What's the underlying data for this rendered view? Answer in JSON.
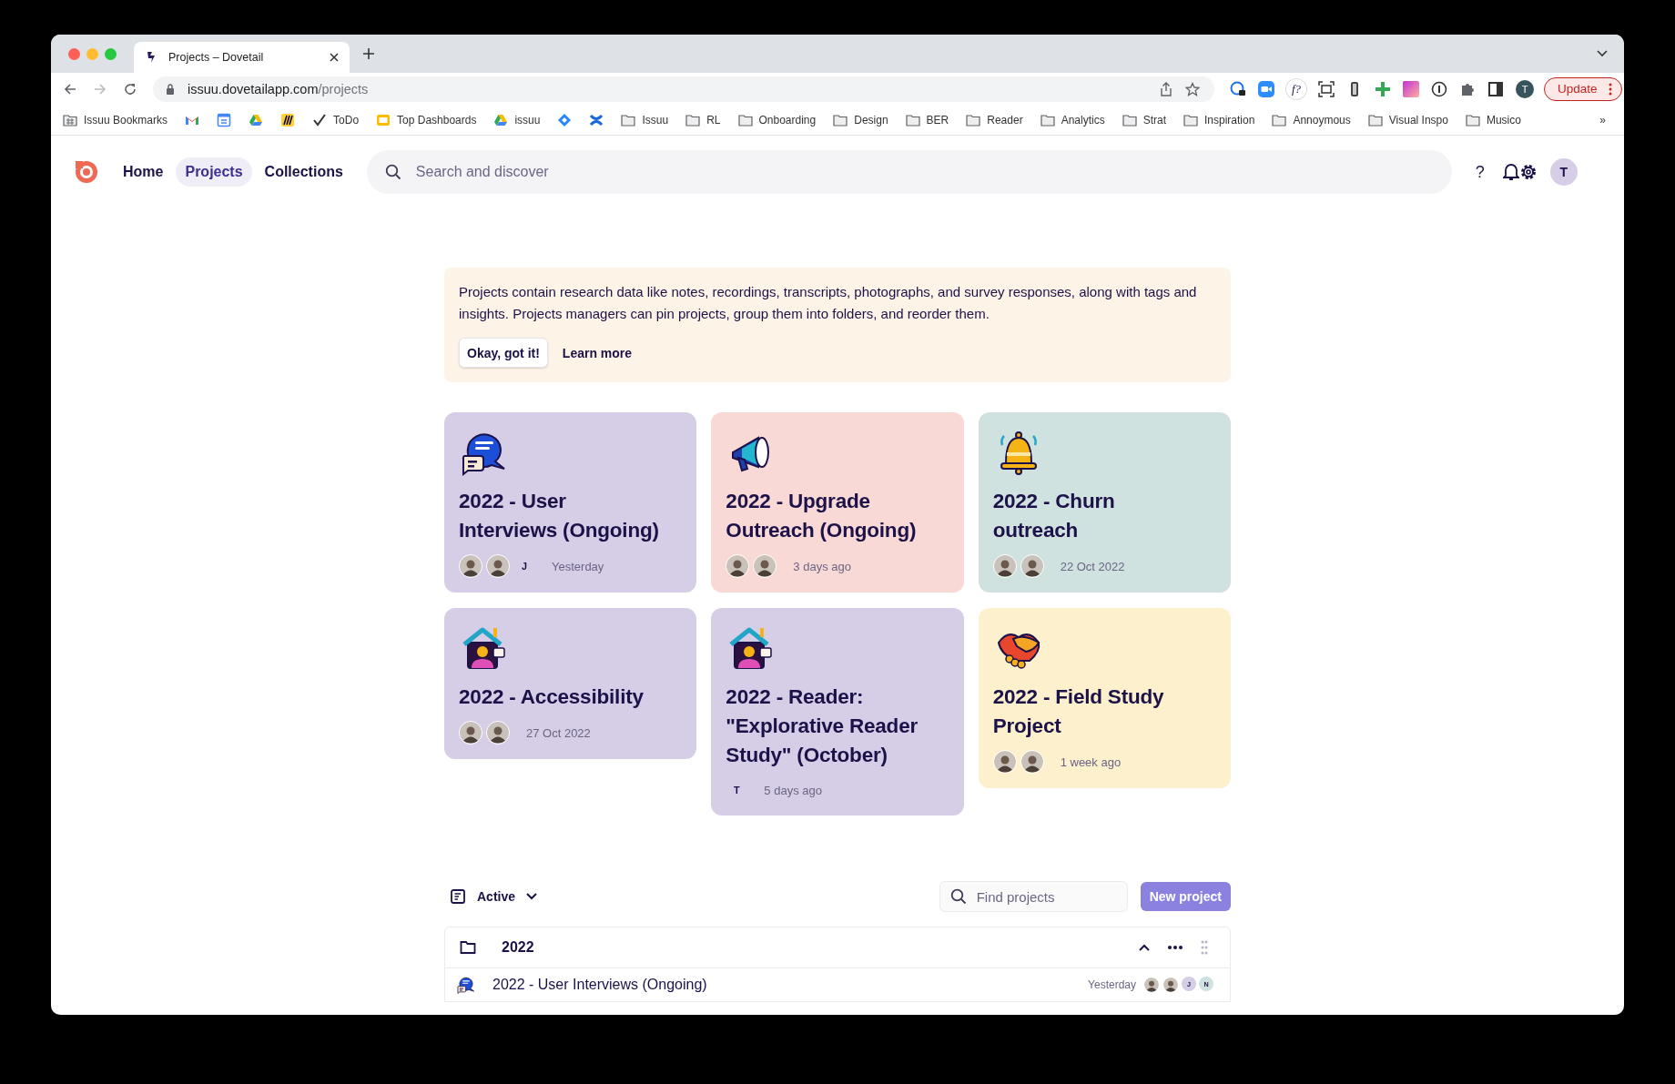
{
  "browser": {
    "tab_title": "Projects – Dovetail",
    "url_host": "issuu.dovetailapp.com",
    "url_path": "/projects",
    "formula_extension": "f?",
    "profile_initial": "T",
    "update_label": "Update",
    "overflow": "»",
    "bookmarks": [
      {
        "kind": "grid",
        "label": "Issuu Bookmarks"
      },
      {
        "kind": "gmail"
      },
      {
        "kind": "calendar"
      },
      {
        "kind": "drive"
      },
      {
        "kind": "miro"
      },
      {
        "kind": "check",
        "label": "ToDo"
      },
      {
        "kind": "slides",
        "label": "Top Dashboards"
      },
      {
        "kind": "drive",
        "label": "issuu"
      },
      {
        "kind": "jira"
      },
      {
        "kind": "confluence"
      },
      {
        "kind": "folder",
        "label": "Issuu"
      },
      {
        "kind": "folder",
        "label": "RL"
      },
      {
        "kind": "folder",
        "label": "Onboarding"
      },
      {
        "kind": "folder",
        "label": "Design"
      },
      {
        "kind": "folder",
        "label": "BER"
      },
      {
        "kind": "folder",
        "label": "Reader"
      },
      {
        "kind": "folder",
        "label": "Analytics"
      },
      {
        "kind": "folder",
        "label": "Strat"
      },
      {
        "kind": "folder",
        "label": "Inspiration"
      },
      {
        "kind": "folder",
        "label": "Annoymous"
      },
      {
        "kind": "folder",
        "label": "Visual Inspo"
      },
      {
        "kind": "folder",
        "label": "Musico"
      }
    ]
  },
  "nav": {
    "items": [
      {
        "label": "Home",
        "selected": false
      },
      {
        "label": "Projects",
        "selected": true
      },
      {
        "label": "Collections",
        "selected": false
      }
    ],
    "search_placeholder": "Search and discover",
    "help": "?",
    "user_initial": "T"
  },
  "banner": {
    "text": "Projects contain research data like notes, recordings, transcripts, photographs, and survey responses, along with tags and insights. Projects managers can pin projects, group them into folders, and reorder them.",
    "primary": "Okay, got it!",
    "secondary": "Learn more"
  },
  "pinned": [
    {
      "kind": "chat",
      "color": "#d6cde6",
      "title": "2022 - User Interviews (Ongoing)",
      "members": [
        {
          "kind": "photo"
        },
        {
          "kind": "photo"
        },
        {
          "kind": "initial",
          "text": "J"
        }
      ],
      "updated": "Yesterday"
    },
    {
      "kind": "megaphone",
      "color": "#f8d9d5",
      "title": "2022 - Upgrade Outreach (Ongoing)",
      "members": [
        {
          "kind": "photo"
        },
        {
          "kind": "photo"
        }
      ],
      "updated": "3 days ago"
    },
    {
      "kind": "bell",
      "color": "#cfe2df",
      "title": "2022 - Churn outreach",
      "members": [
        {
          "kind": "photo"
        },
        {
          "kind": "photo"
        }
      ],
      "updated": "22 Oct 2022"
    },
    {
      "kind": "house",
      "color": "#d6cde6",
      "title": "2022 - Accessibility",
      "members": [
        {
          "kind": "photo"
        },
        {
          "kind": "photo"
        }
      ],
      "updated": "27 Oct 2022"
    },
    {
      "kind": "house",
      "color": "#d6cde6",
      "title": "2022 - Reader: \"Explorative Reader Study\" (October)",
      "members": [
        {
          "kind": "initial",
          "text": "T"
        }
      ],
      "updated": "5 days ago"
    },
    {
      "kind": "handshake",
      "color": "#fdf0cc",
      "title": "2022 - Field Study Project",
      "members": [
        {
          "kind": "photo"
        },
        {
          "kind": "photo"
        }
      ],
      "updated": "1 week ago"
    }
  ],
  "toolbar": {
    "filter": "Active",
    "search_placeholder": "Find projects",
    "new_button": "New project"
  },
  "folder": {
    "name": "2022",
    "expanded": true,
    "projects": [
      {
        "kind": "chat",
        "title": "2022 - User Interviews (Ongoing)",
        "updated": "Yesterday",
        "members": [
          {
            "kind": "photo"
          },
          {
            "kind": "photo"
          },
          {
            "kind": "initial",
            "text": "J",
            "color": "#d6cde6"
          },
          {
            "kind": "initial",
            "text": "N",
            "color": "#cfe2df"
          }
        ]
      }
    ]
  }
}
